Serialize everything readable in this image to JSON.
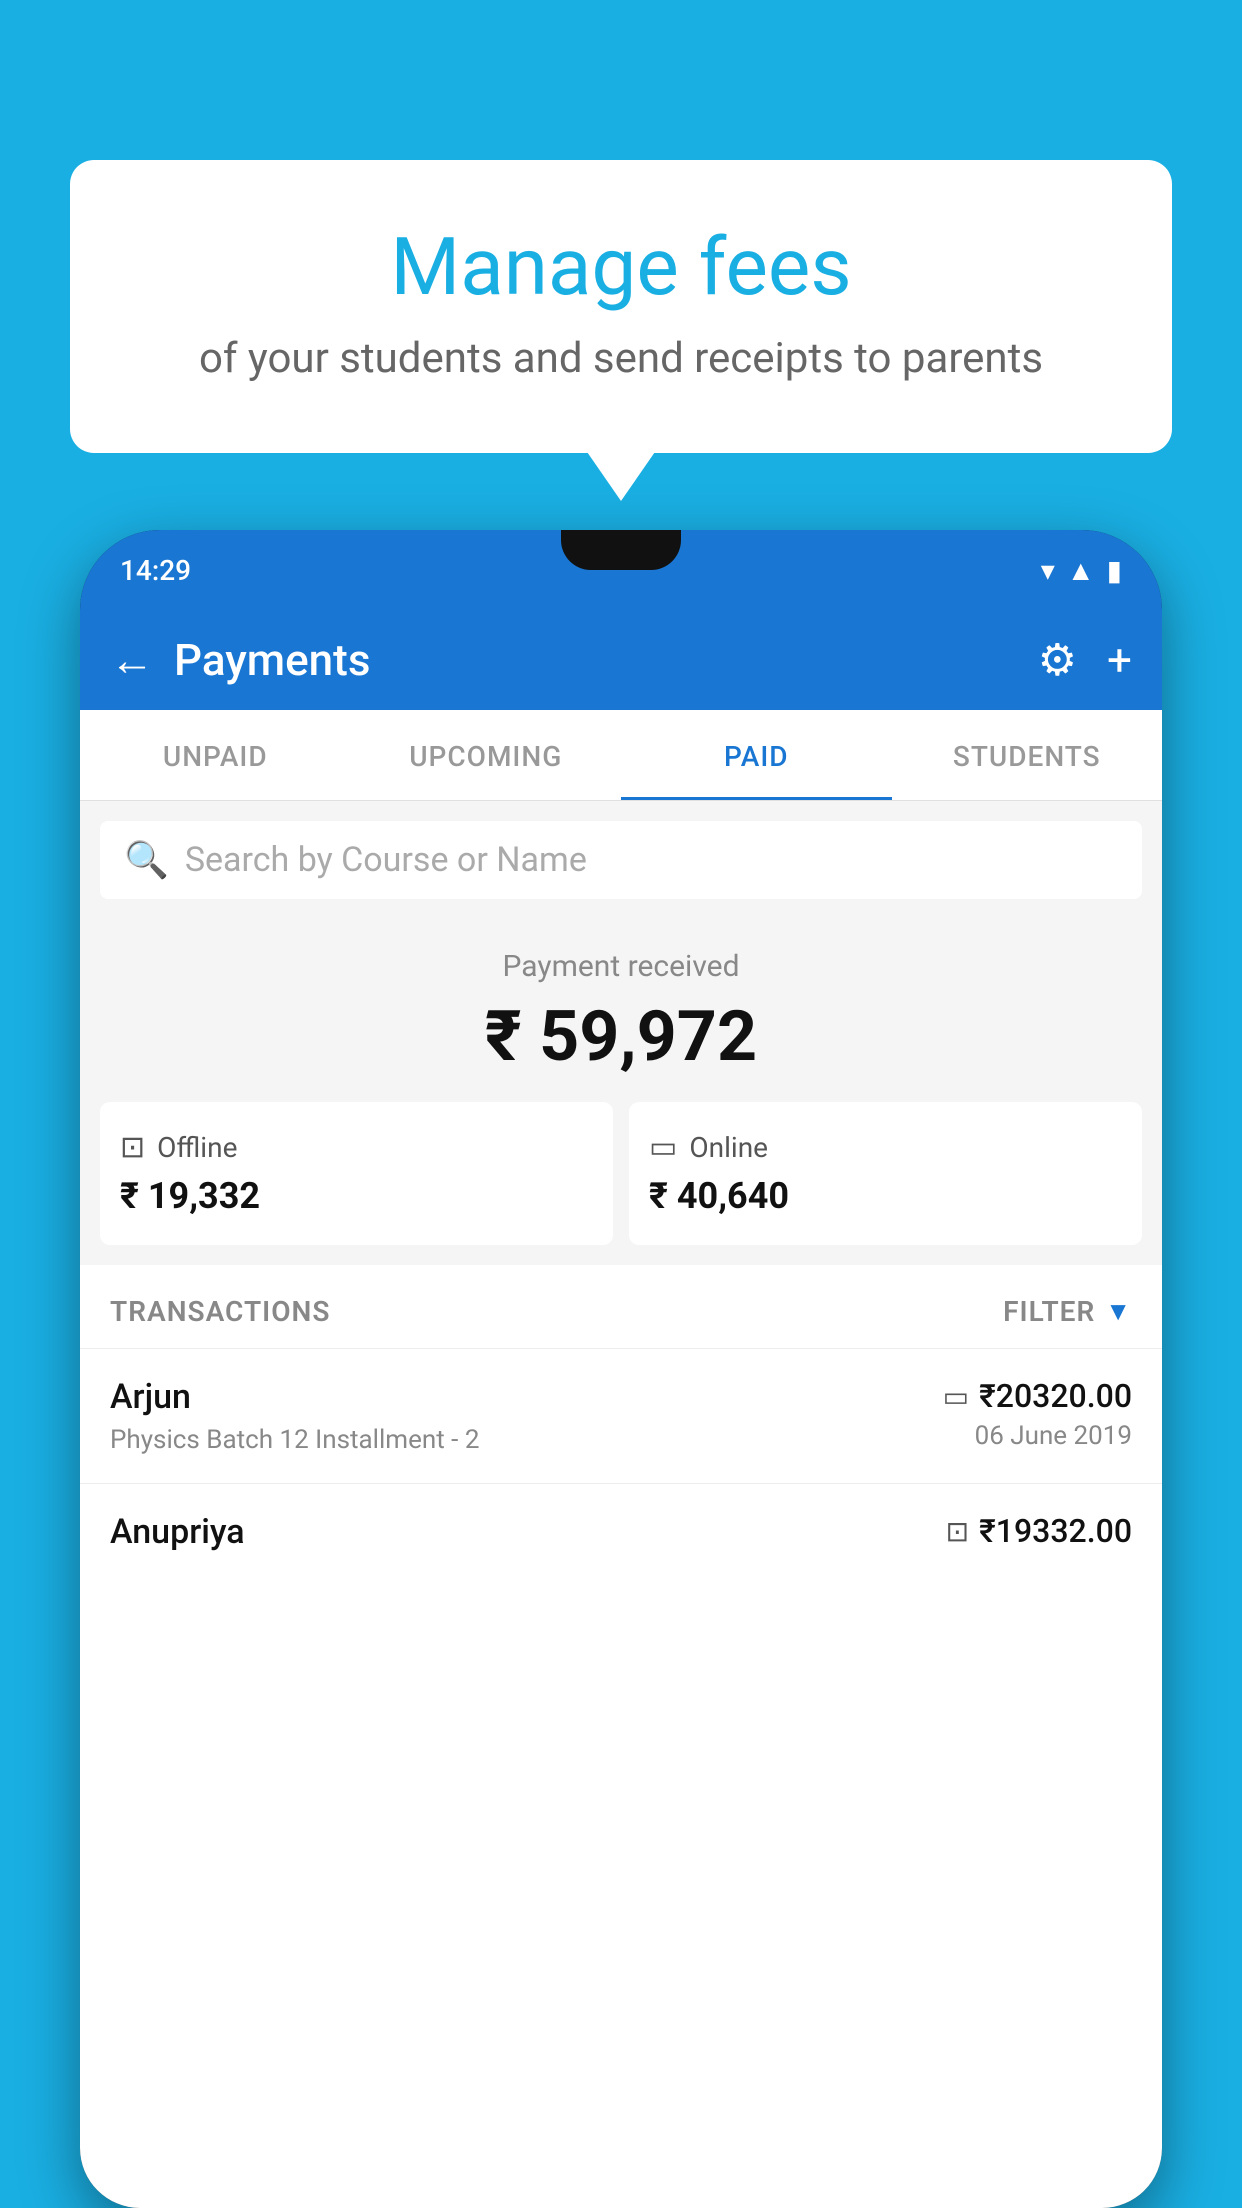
{
  "background_color": "#1AAFE3",
  "speech_bubble": {
    "title": "Manage fees",
    "subtitle": "of your students and send receipts to parents"
  },
  "phone": {
    "status_bar": {
      "time": "14:29",
      "icons": [
        "wifi",
        "signal",
        "battery"
      ]
    },
    "header": {
      "back_label": "←",
      "title": "Payments",
      "settings_icon": "⚙",
      "add_icon": "+"
    },
    "tabs": [
      {
        "label": "UNPAID",
        "active": false
      },
      {
        "label": "UPCOMING",
        "active": false
      },
      {
        "label": "PAID",
        "active": true
      },
      {
        "label": "STUDENTS",
        "active": false
      }
    ],
    "search": {
      "placeholder": "Search by Course or Name"
    },
    "payment_summary": {
      "label": "Payment received",
      "total": "₹ 59,972",
      "offline": {
        "icon": "💳",
        "label": "Offline",
        "amount": "₹ 19,332"
      },
      "online": {
        "icon": "💳",
        "label": "Online",
        "amount": "₹ 40,640"
      }
    },
    "transactions": {
      "label": "TRANSACTIONS",
      "filter_label": "FILTER",
      "rows": [
        {
          "name": "Arjun",
          "detail": "Physics Batch 12 Installment - 2",
          "amount": "₹20320.00",
          "date": "06 June 2019",
          "payment_type": "online"
        },
        {
          "name": "Anupriya",
          "detail": "",
          "amount": "₹19332.00",
          "date": "",
          "payment_type": "offline"
        }
      ]
    }
  }
}
